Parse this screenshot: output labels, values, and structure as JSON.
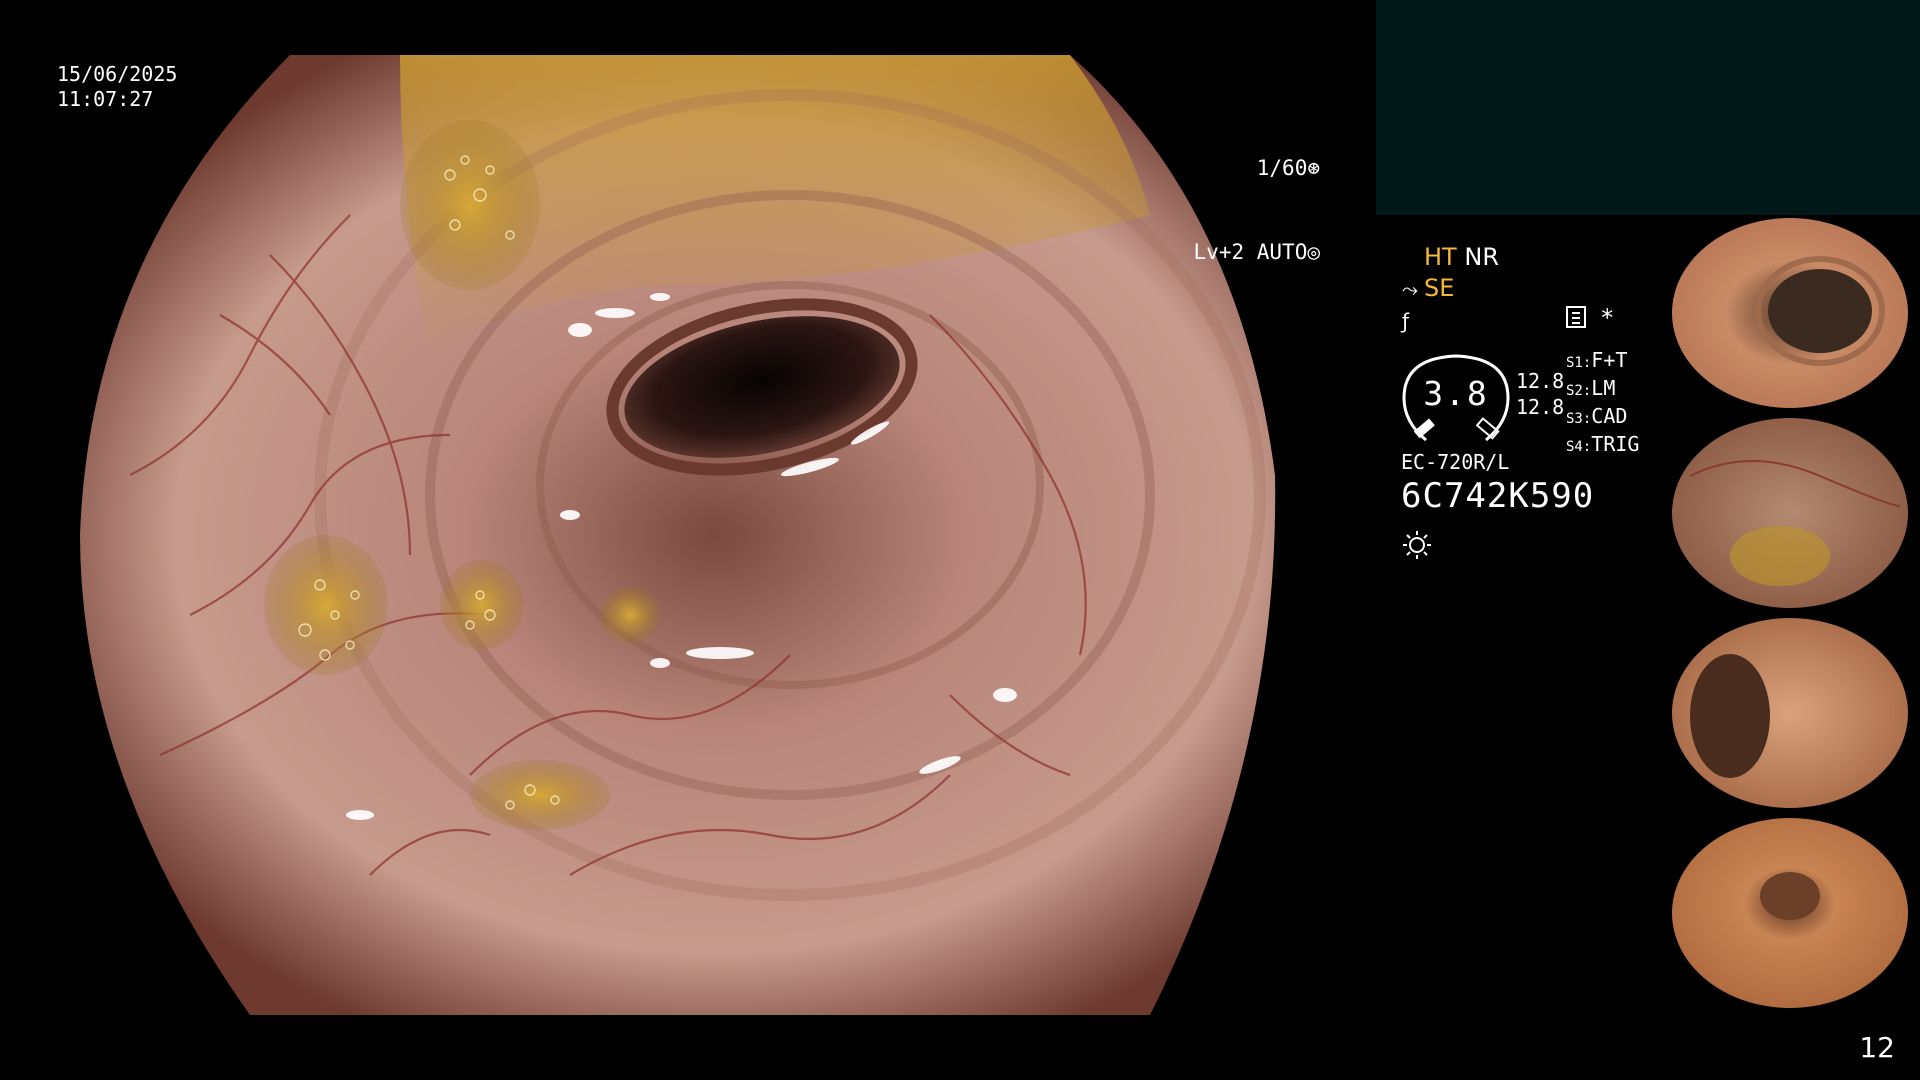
{
  "osd": {
    "date": "15/06/2025",
    "time": "11:07:27",
    "shutter": "1/60",
    "level": "Lv+2",
    "exposure_mode": "AUTO"
  },
  "modes": {
    "ht": "HT",
    "nr": "NR",
    "se": "SE",
    "scope_icon": "scope-icon",
    "f_icon": "f-slash-icon",
    "menu_icon": "list-icon",
    "star": "*"
  },
  "zoom": {
    "value": "3.8",
    "side_top": "12.8",
    "side_bottom": "12.8"
  },
  "scope_settings": [
    {
      "key": "S1:",
      "value": "F+T"
    },
    {
      "key": "S2:",
      "value": "LM"
    },
    {
      "key": "S3:",
      "value": "CAD"
    },
    {
      "key": "S4:",
      "value": "TRIG"
    }
  ],
  "scope": {
    "model": "EC-720R/L",
    "serial": "6C742K590"
  },
  "thumbnails": [
    {
      "name": "thumbnail-1"
    },
    {
      "name": "thumbnail-2"
    },
    {
      "name": "thumbnail-3"
    },
    {
      "name": "thumbnail-4"
    }
  ],
  "page": {
    "number": "12"
  },
  "colors": {
    "highlight": "#f5b83a",
    "status_panel": "#011a19",
    "background": "#000000"
  }
}
